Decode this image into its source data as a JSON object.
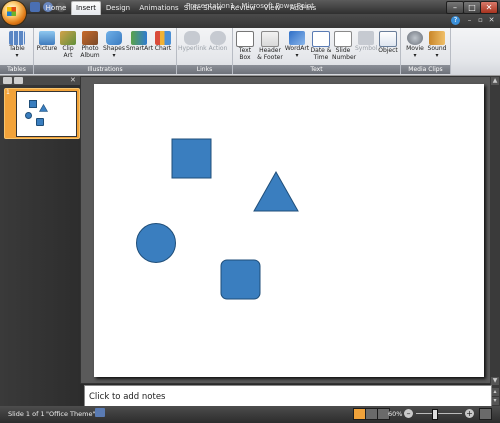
{
  "window": {
    "title": "Presentation1 - Microsoft PowerPoint"
  },
  "ribbon_tabs": [
    "Home",
    "Insert",
    "Design",
    "Animations",
    "Slide Show",
    "Review",
    "View",
    "Add-Ins"
  ],
  "active_tab": "Insert",
  "groups": {
    "tables": "Tables",
    "illustrations": "Illustrations",
    "links": "Links",
    "text": "Text",
    "media": "Media Clips"
  },
  "buttons": {
    "table": "Table",
    "picture": "Picture",
    "clipart": "Clip Art",
    "photoalbum": "Photo Album",
    "shapes": "Shapes",
    "smartart": "SmartArt",
    "chart": "Chart",
    "hyperlink": "Hyperlink",
    "action": "Action",
    "textbox": "Text Box",
    "headerfooter": "Header & Footer",
    "wordart": "WordArt",
    "datetime": "Date & Time",
    "slidenumber": "Slide Number",
    "symbol": "Symbol",
    "object": "Object",
    "movie": "Movie",
    "sound": "Sound"
  },
  "thumbnail": {
    "slide_number": "1"
  },
  "slide": {
    "shapes": [
      "square",
      "triangle",
      "circle",
      "rounded-square"
    ],
    "shape_fill": "#3a7ebf",
    "shape_stroke": "#1f4e79"
  },
  "notes": {
    "placeholder": "Click to add notes"
  },
  "status": {
    "slide_indicator": "Slide 1 of 1",
    "theme": "\"Office Theme\"",
    "zoom": "60%"
  },
  "colors": {
    "accent": "#f0a23a",
    "ribbon_bg": "#e4e6ea",
    "frame": "#2f2f2f"
  }
}
